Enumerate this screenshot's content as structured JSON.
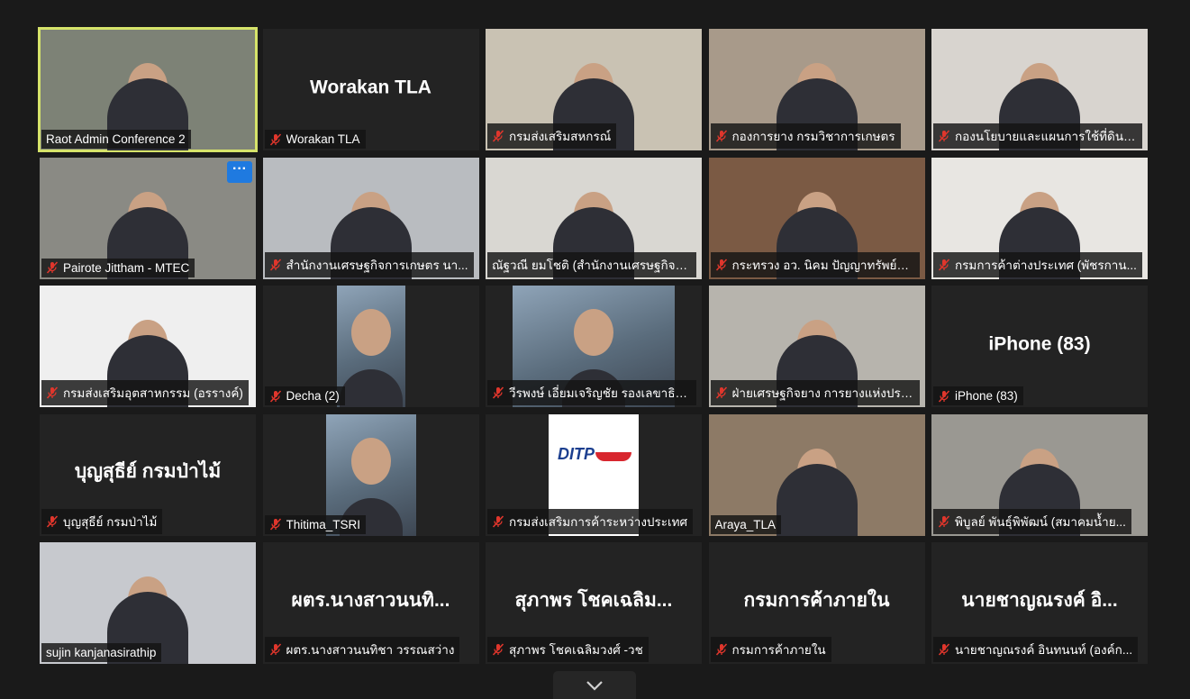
{
  "participants": [
    {
      "name": "Raot Admin Conference 2",
      "display_name": "",
      "muted": false,
      "active": true,
      "video": true,
      "bg": "#7d8276"
    },
    {
      "name": "Worakan TLA",
      "display_name": "Worakan TLA",
      "muted": true,
      "video": false
    },
    {
      "name": "กรมส่งเสริมสหกรณ์",
      "display_name": "",
      "muted": true,
      "video": true,
      "bg": "#c9c2b3"
    },
    {
      "name": "กองการยาง กรมวิชาการเกษตร",
      "display_name": "",
      "muted": true,
      "video": true,
      "bg": "#a89a8a"
    },
    {
      "name": "กองนโยบายและแผนการใช้ที่ดิน ก...",
      "display_name": "",
      "muted": true,
      "video": true,
      "bg": "#d8d4cf"
    },
    {
      "name": "Pairote Jittham - MTEC",
      "display_name": "",
      "muted": true,
      "video": true,
      "bg": "#8a8a84",
      "more": true
    },
    {
      "name": "สำนักงานเศรษฐกิจการเกษตร นา...",
      "display_name": "",
      "muted": true,
      "video": true,
      "bg": "#b9bcc0"
    },
    {
      "name": "ณัฐวณี ยมโชติ (สำนักงานเศรษฐกิจก...",
      "display_name": "",
      "muted": false,
      "video": true,
      "bg": "#d9d7d2"
    },
    {
      "name": "กระทรวง อว. นิคม ปัญญาทรัพย์กิจไพ...",
      "display_name": "",
      "muted": true,
      "video": true,
      "bg": "#7b5a44"
    },
    {
      "name": "กรมการค้าต่างประเทศ (พัชรกาน...",
      "display_name": "",
      "muted": true,
      "video": true,
      "bg": "#e8e6e2"
    },
    {
      "name": "กรมส่งเสริมอุตสาหกรรม (อรรางค์)",
      "display_name": "",
      "muted": true,
      "video": true,
      "bg": "#efefef"
    },
    {
      "name": "Decha (2)",
      "display_name": "",
      "muted": true,
      "video": true,
      "bg": "#232323",
      "inset_w": 76
    },
    {
      "name": "วีรพงษ์ เอี่ยมเจริญชัย รองเลขาธิก...",
      "display_name": "",
      "muted": true,
      "video": true,
      "bg": "#232323",
      "inset_w": 180
    },
    {
      "name": "ฝ่ายเศรษฐกิจยาง การยางแห่งประเ...",
      "display_name": "",
      "muted": true,
      "video": true,
      "bg": "#b7b4ad"
    },
    {
      "name": "iPhone (83)",
      "display_name": "iPhone (83)",
      "muted": true,
      "video": false
    },
    {
      "name": "บุญสุธีย์ กรมป่าไม้",
      "display_name": "บุญสุธีย์ กรมป่าไม้",
      "muted": true,
      "video": false
    },
    {
      "name": "Thitima_TSRI",
      "display_name": "",
      "muted": true,
      "video": true,
      "bg": "#232323",
      "inset_w": 100
    },
    {
      "name": "กรมส่งเสริมการค้าระหว่างประเทศ",
      "display_name": "",
      "muted": true,
      "video": true,
      "bg": "#232323",
      "inset_w": 100,
      "logo": "DITP"
    },
    {
      "name": "Araya_TLA",
      "display_name": "",
      "muted": false,
      "video": true,
      "bg": "#8d7a66"
    },
    {
      "name": "พิบูลย์ พันธุ์พิพัฒน์ (สมาคมน้ำย...",
      "display_name": "",
      "muted": true,
      "video": true,
      "bg": "#9a9892"
    },
    {
      "name": "sujin kanjanasirathip",
      "display_name": "",
      "muted": false,
      "video": true,
      "bg": "#c7c9ce"
    },
    {
      "name": "ผตร.นางสาวนนทิชา วรรณสว่าง",
      "display_name": "ผตร.นางสาวนนทิ...",
      "muted": true,
      "video": false
    },
    {
      "name": "สุภาพร โชคเฉลิมวงศ์ -วช",
      "display_name": "สุภาพร โชคเฉลิม...",
      "muted": true,
      "video": false
    },
    {
      "name": "กรมการค้าภายใน",
      "display_name": "กรมการค้าภายใน",
      "muted": true,
      "video": false
    },
    {
      "name": "นายชาญณรงค์ อินทนนท์ (องค์ก...",
      "display_name": "นายชาญณรงค์ อิ...",
      "muted": true,
      "video": false
    }
  ],
  "colors": {
    "active_outline": "#d6e36a",
    "mute_red": "#e0362c",
    "more_blue": "#1f7ae0"
  },
  "icons": {
    "mute": "microphone-muted-icon",
    "more": "ellipsis-icon",
    "scroll": "chevron-down-icon"
  }
}
